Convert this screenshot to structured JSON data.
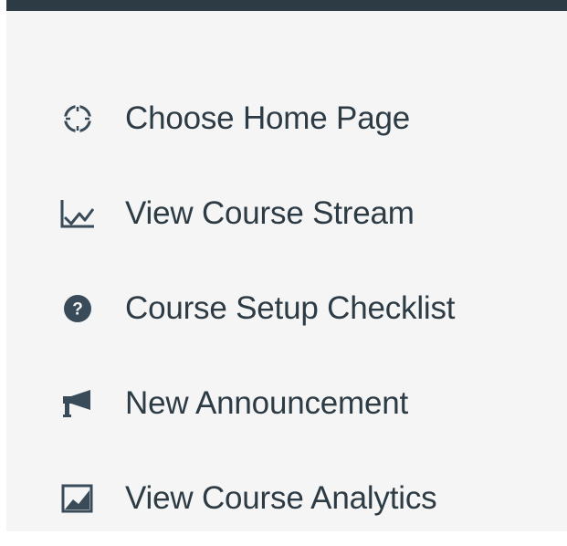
{
  "menu": {
    "items": [
      {
        "label": "Choose Home Page",
        "icon": "crosshair-circle-icon"
      },
      {
        "label": "View Course Stream",
        "icon": "line-chart-icon"
      },
      {
        "label": "Course Setup Checklist",
        "icon": "question-circle-icon"
      },
      {
        "label": "New Announcement",
        "icon": "megaphone-icon"
      },
      {
        "label": "View Course Analytics",
        "icon": "image-analytics-icon"
      }
    ]
  },
  "colors": {
    "text": "#2d3b45",
    "icon": "#394b58",
    "panel_background": "#f5f5f5",
    "topbar": "#2d3b45"
  }
}
